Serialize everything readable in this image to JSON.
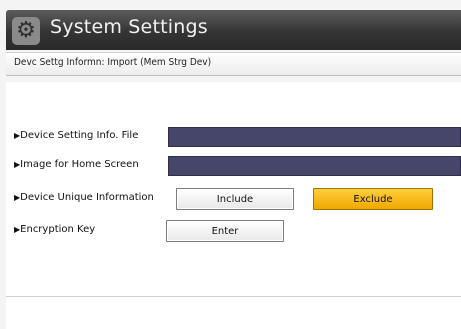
{
  "header": {
    "title": "System Settings",
    "icon": "gear-icon"
  },
  "breadcrumb": "Devc Settg Informn: Import (Mem Strg Dev)",
  "rows": [
    {
      "label": "Device Setting Info. File",
      "value": ""
    },
    {
      "label": "Image for Home Screen",
      "value": ""
    },
    {
      "label": "Device Unique Information",
      "options": [
        "Include",
        "Exclude"
      ],
      "selected": "Exclude"
    },
    {
      "label": "Encryption Key",
      "button": "Enter"
    }
  ],
  "colors": {
    "title_bar": "#343434",
    "field": "#46466a",
    "selected": "#f5b400"
  }
}
